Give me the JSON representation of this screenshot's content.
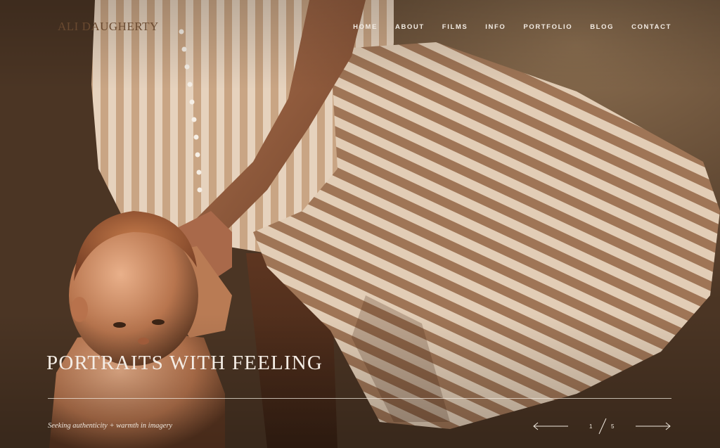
{
  "site": {
    "logo_text": "ALI DAUGHERTY"
  },
  "nav": {
    "items": [
      {
        "label": "HOME"
      },
      {
        "label": "ABOUT"
      },
      {
        "label": "FILMS"
      },
      {
        "label": "INFO"
      },
      {
        "label": "PORTFOLIO"
      },
      {
        "label": "BLOG"
      },
      {
        "label": "CONTACT"
      }
    ]
  },
  "hero": {
    "headline": "PORTRAITS WITH FEELING",
    "tagline": "Seeking authenticity + warmth in imagery"
  },
  "slider": {
    "current": "1",
    "total": "5",
    "prev_icon": "arrow-left-icon",
    "next_icon": "arrow-right-icon"
  },
  "colors": {
    "text_light": "#f3ece4",
    "logo": "#6a4a30",
    "stripe_light": "#e8d4c0",
    "stripe_dark": "#a9805f"
  }
}
